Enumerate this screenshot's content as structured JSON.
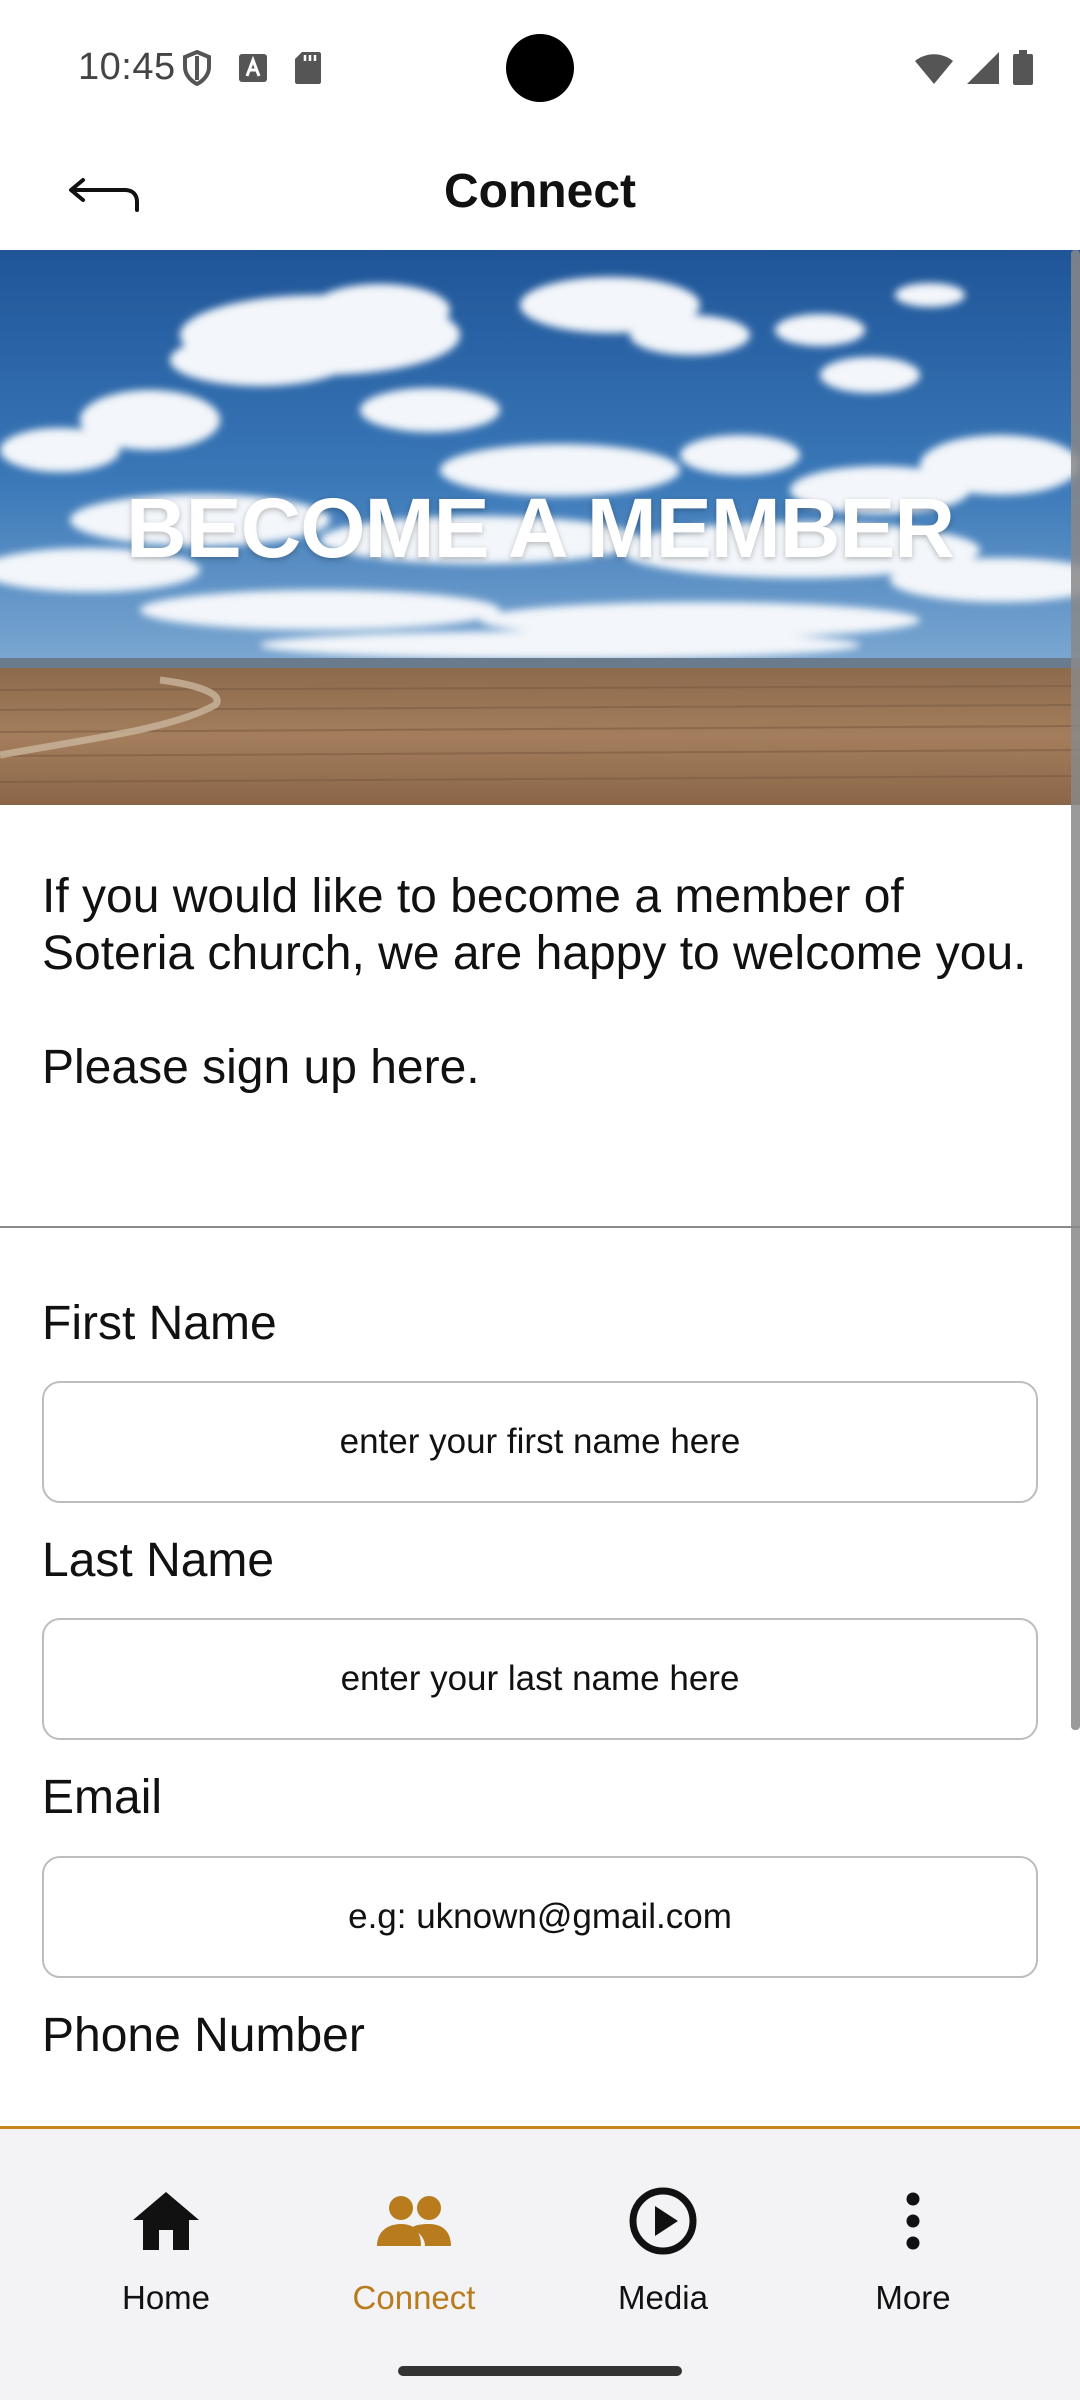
{
  "status_bar": {
    "time": "10:45"
  },
  "app_bar": {
    "title": "Connect",
    "back_icon": "back-arrow-icon"
  },
  "hero": {
    "title": "BECOME A MEMBER"
  },
  "intro": {
    "paragraph": "If you would like to become a member of Soteria church, we are happy to welcome you.",
    "sign_up": "Please sign up here."
  },
  "form": {
    "first_name": {
      "label": "First Name",
      "placeholder": "enter your first name here"
    },
    "last_name": {
      "label": "Last Name",
      "placeholder": "enter your last name here"
    },
    "email": {
      "label": "Email",
      "placeholder": "e.g: uknown@gmail.com"
    },
    "phone": {
      "label": "Phone Number"
    }
  },
  "bottom_nav": {
    "items": [
      {
        "label": "Home",
        "icon": "home-icon",
        "active": false
      },
      {
        "label": "Connect",
        "icon": "people-icon",
        "active": true
      },
      {
        "label": "Media",
        "icon": "play-circle-icon",
        "active": false
      },
      {
        "label": "More",
        "icon": "more-vertical-icon",
        "active": false
      }
    ]
  },
  "colors": {
    "accent": "#b87c1e",
    "nav_background": "#f3f3f6",
    "sky": "#2f6aa8",
    "field": "#9a7654"
  }
}
